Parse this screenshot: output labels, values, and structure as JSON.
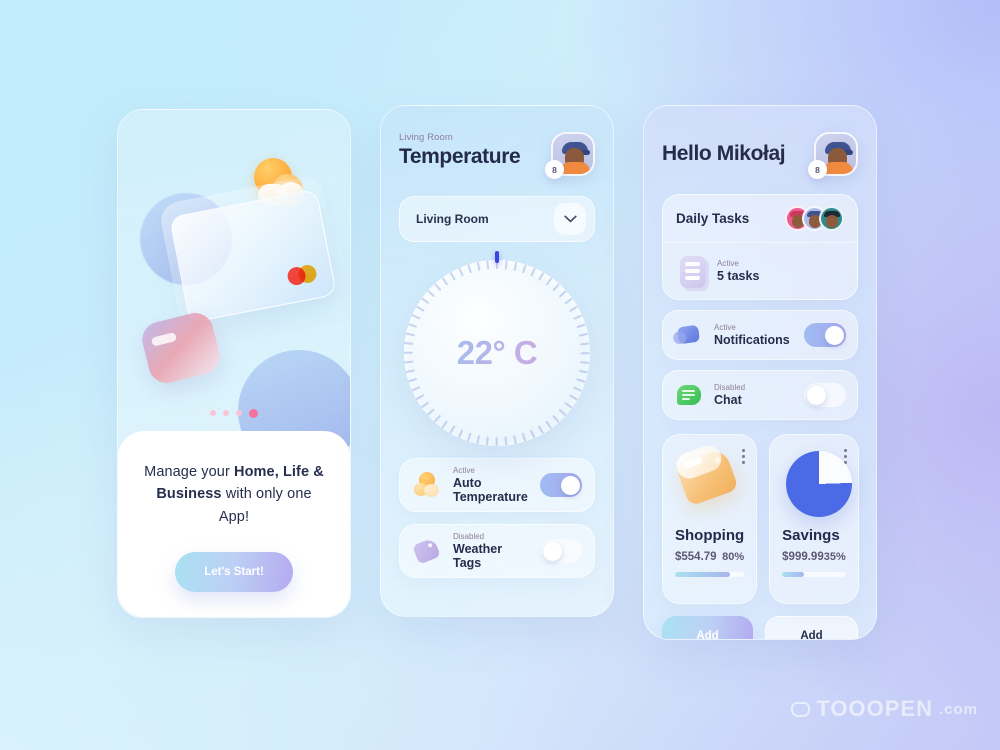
{
  "background": {
    "gradient_from": "#bfeafb",
    "gradient_to": "#b4bdf9",
    "watermark": "TOOOPEN",
    "watermark_suffix": ".com"
  },
  "screen_onboarding": {
    "icons": {
      "sun": "sun-cloud-icon",
      "card": "credit-card-icon",
      "wallet": "wallet-icon"
    },
    "pager": {
      "count": 4,
      "active_index": 3
    },
    "headline_parts": [
      {
        "text": "Manage your ",
        "bold": false
      },
      {
        "text": "Home, Life & Business",
        "bold": true
      },
      {
        "text": " with only one App!",
        "bold": false
      }
    ],
    "cta_label": "Let's Start!"
  },
  "screen_temperature": {
    "eyebrow": "Living Room",
    "title": "Temperature",
    "avatar": {
      "badge": "8"
    },
    "room_select": {
      "value": "Living Room",
      "icon": "chevron-down-icon"
    },
    "dial": {
      "value": "22° C",
      "temperature": 22,
      "unit": "C",
      "handle_position_deg": 0,
      "tick_count": 60
    },
    "settings": [
      {
        "state": "Active",
        "label": "Auto Temperature",
        "toggle": "on",
        "icon": "sun-icon"
      },
      {
        "state": "Disabled",
        "label": "Weather Tags",
        "toggle": "off",
        "icon": "tag-icon"
      }
    ]
  },
  "screen_home": {
    "greeting": "Hello Mikołaj",
    "avatar": {
      "badge": "8"
    },
    "tasks_card": {
      "title": "Daily Tasks",
      "members": [
        {
          "name": "member-1",
          "color": "#ef5a8c",
          "hat": "#c93a5f"
        },
        {
          "name": "member-2",
          "color": "#aebbe6",
          "hat": "#41528f"
        },
        {
          "name": "member-3",
          "color": "#2f8b8b",
          "hat": "#1f2a33"
        }
      ],
      "state": "Active",
      "count_label": "5 tasks",
      "icon": "tasks-icon"
    },
    "switches": [
      {
        "state": "Active",
        "label": "Notifications",
        "toggle": "on",
        "icon": "bell-icon"
      },
      {
        "state": "Disabled",
        "label": "Chat",
        "toggle": "off",
        "icon": "chat-icon"
      }
    ],
    "money_cards": [
      {
        "title": "Shopping",
        "amount": "$554.79",
        "percent_label": "80%",
        "percent": 80,
        "icon": "price-tag-icon",
        "menu": "kebab-menu-icon",
        "action_label": "Add"
      },
      {
        "title": "Savings",
        "amount": "$999.99",
        "percent_label": "35%",
        "percent": 35,
        "icon": "pie-chart-icon",
        "menu": "kebab-menu-icon",
        "action_label": "Add"
      }
    ]
  }
}
